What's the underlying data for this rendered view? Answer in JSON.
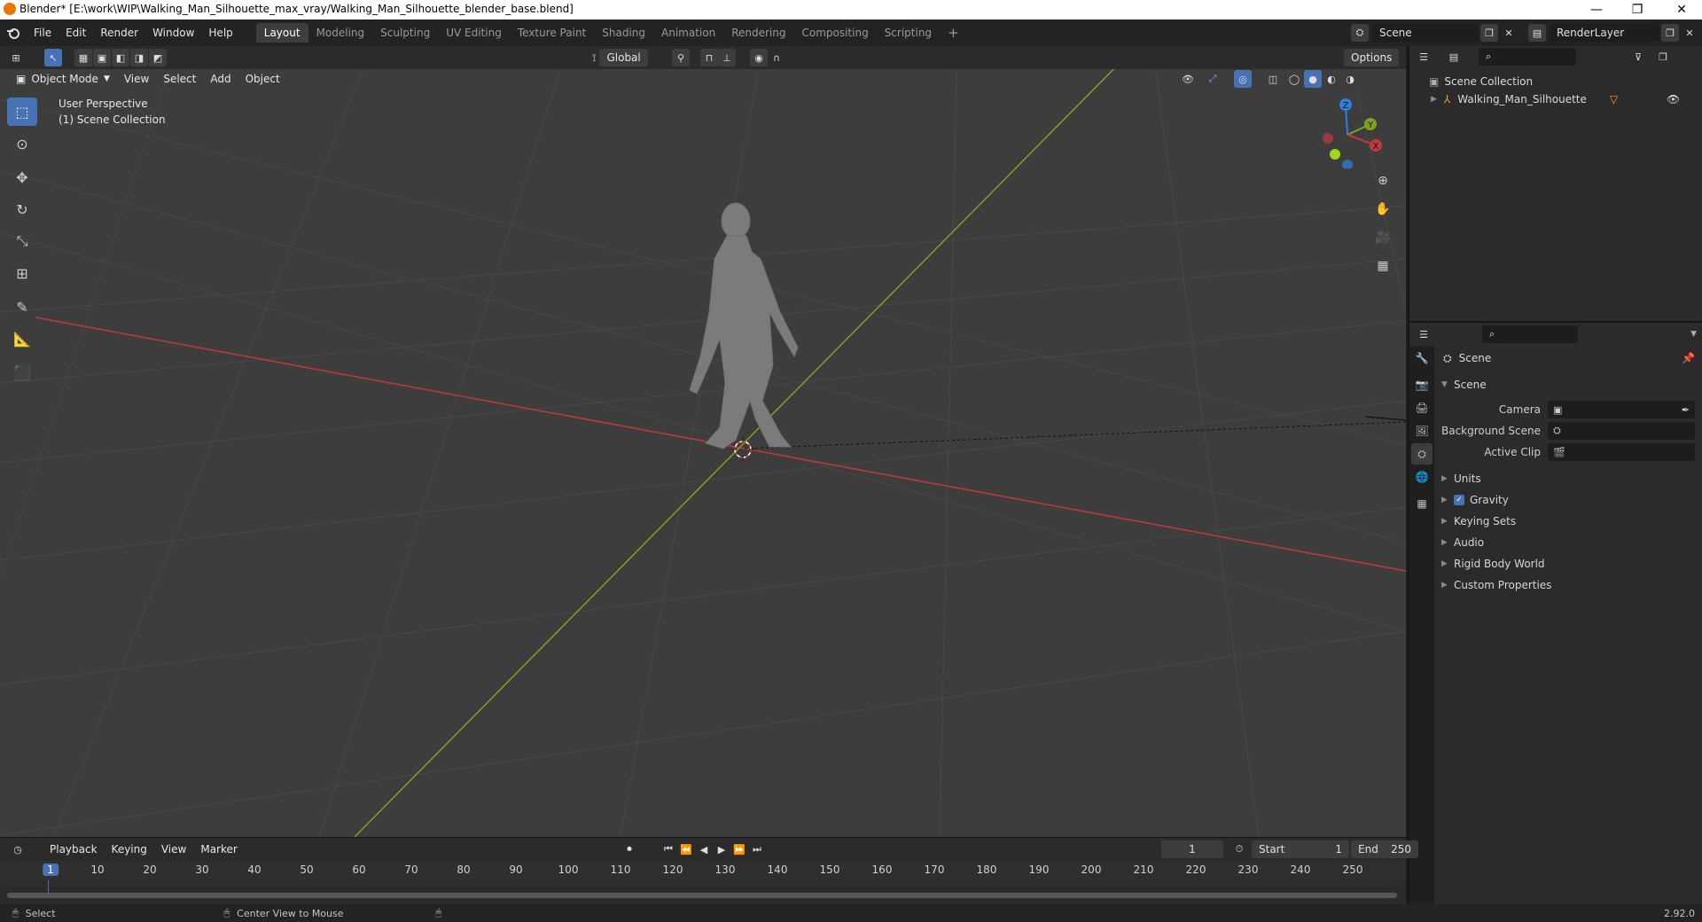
{
  "window": {
    "title": "Blender* [E:\\work\\WIP\\Walking_Man_Silhouette_max_vray/Walking_Man_Silhouette_blender_base.blend]",
    "minimize": "—",
    "maximize": "❐",
    "close": "✕"
  },
  "menubar": {
    "items": [
      "File",
      "Edit",
      "Render",
      "Window",
      "Help"
    ],
    "workspaces": [
      "Layout",
      "Modeling",
      "Sculpting",
      "UV Editing",
      "Texture Paint",
      "Shading",
      "Animation",
      "Rendering",
      "Compositing",
      "Scripting"
    ],
    "active_workspace": "Layout",
    "add_tab": "+",
    "scene_name": "Scene",
    "view_layer": "RenderLayer"
  },
  "viewport_header": {
    "mode": "Object Mode",
    "menus": [
      "View",
      "Select",
      "Add",
      "Object"
    ],
    "orientation": "Global",
    "options": "Options"
  },
  "viewport": {
    "perspective": "User Perspective",
    "collection": "(1) Scene Collection",
    "gizmo": {
      "x": "X",
      "y": "Y",
      "z": "Z"
    }
  },
  "outliner": {
    "root": "Scene Collection",
    "items": [
      {
        "name": "Walking_Man_Silhouette"
      }
    ]
  },
  "properties": {
    "context": "Scene",
    "panel_title": "Scene",
    "fields": [
      {
        "label": "Camera"
      },
      {
        "label": "Background Scene"
      },
      {
        "label": "Active Clip"
      }
    ],
    "subpanels": [
      "Units",
      "Gravity",
      "Keying Sets",
      "Audio",
      "Rigid Body World",
      "Custom Properties"
    ],
    "gravity_checked": true
  },
  "timeline": {
    "menus": [
      "Playback",
      "Keying",
      "View",
      "Marker"
    ],
    "current_frame": "1",
    "start_label": "Start",
    "start": "1",
    "end_label": "End",
    "end": "250",
    "ticks": [
      "1",
      "10",
      "20",
      "30",
      "40",
      "50",
      "60",
      "70",
      "80",
      "90",
      "100",
      "110",
      "120",
      "130",
      "140",
      "150",
      "160",
      "170",
      "180",
      "190",
      "200",
      "210",
      "220",
      "230",
      "240",
      "250"
    ]
  },
  "statusbar": {
    "select": "Select",
    "center_view": "Center View to Mouse",
    "version": "2.92.0"
  },
  "colors": {
    "accent": "#4772b3",
    "x_axis": "#c0393b",
    "y_axis": "#7ea21d",
    "z_axis": "#2f7fe0",
    "viewport_bg": "#3d3d3d"
  }
}
